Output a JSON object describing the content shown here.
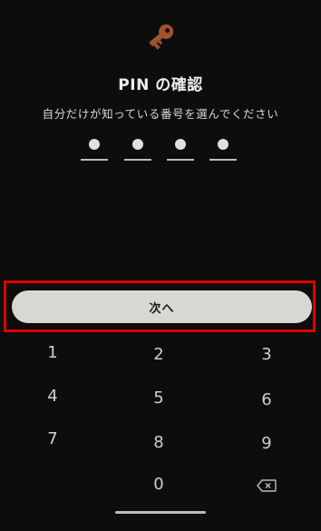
{
  "header": {
    "icon": "key-icon",
    "icon_color": "#a0522d",
    "title": "PIN の確認",
    "subtitle": "自分だけが知っている番号を選んでください"
  },
  "pin": {
    "length": 4,
    "entered": 4
  },
  "next_button": {
    "label": "次へ",
    "highlighted": true,
    "highlight_color": "#e00000"
  },
  "keypad": {
    "keys": [
      "1",
      "2",
      "3",
      "4",
      "5",
      "6",
      "7",
      "8",
      "9",
      "0"
    ],
    "backspace_icon": "backspace-icon"
  }
}
